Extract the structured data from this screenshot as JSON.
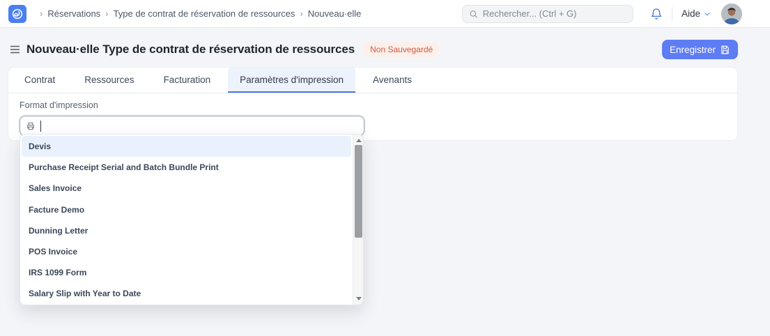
{
  "navbar": {
    "breadcrumb": {
      "separator": "›",
      "items": [
        "Réservations",
        "Type de contrat de réservation de ressources",
        "Nouveau·elle"
      ]
    },
    "search_placeholder": "Rechercher... (Ctrl + G)",
    "help_label": "Aide"
  },
  "page": {
    "title": "Nouveau·elle Type de contrat de réservation de ressources",
    "status_badge": "Non Sauvegardé",
    "save_button_label": "Enregistrer"
  },
  "tabs": [
    {
      "label": "Contrat",
      "active": false
    },
    {
      "label": "Ressources",
      "active": false
    },
    {
      "label": "Facturation",
      "active": false
    },
    {
      "label": "Paramètres d'impression",
      "active": true
    },
    {
      "label": "Avenants",
      "active": false
    }
  ],
  "form": {
    "field_label": "Format d'impression",
    "input_value": "",
    "input_placeholder": ""
  },
  "dropdown": {
    "items": [
      "Devis",
      "Purchase Receipt Serial and Batch Bundle Print",
      "Sales Invoice",
      "Facture Demo",
      "Dunning Letter",
      "POS Invoice",
      "IRS 1099 Form",
      "Salary Slip with Year to Date"
    ],
    "highlighted_item": "Devis"
  },
  "icons": {
    "logo": "swirl-logo",
    "search": "magnifier",
    "notifications": "bell",
    "help": "chevron-down",
    "title_menu": "hamburger",
    "save": "floppy-disk",
    "print_format_field": "printer",
    "scroll_up": "triangle-up",
    "scroll_down": "triangle-down"
  },
  "colors": {
    "accent_blue": "#5e7cf3",
    "tab_underline": "#4c74e8",
    "active_tab_bg": "#edf3fd",
    "badge_bg": "#fdf0ea",
    "badge_text": "#cd5a45",
    "highlight_row_bg": "#e9f1fc",
    "bell_blue": "#3d72e4",
    "page_bg": "#f4f5f9"
  }
}
